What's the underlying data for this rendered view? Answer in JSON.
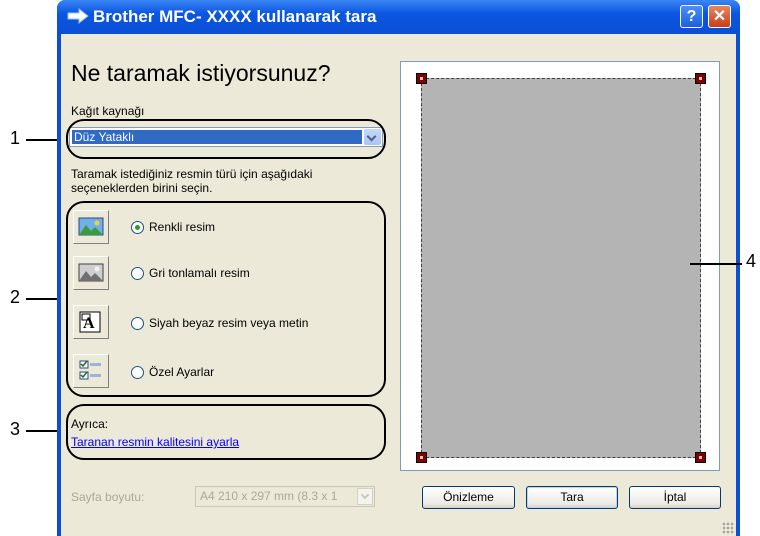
{
  "window": {
    "title": "Brother MFC- XXXX   kullanarak tara",
    "help_glyph": "?",
    "close_glyph": "✕"
  },
  "heading": "Ne taramak istiyorsunuz?",
  "paper_source": {
    "label": "Kağıt kaynağı",
    "selected": "Düz Yataklı"
  },
  "instruction": {
    "line1": "Taramak istediğiniz resmin türü için aşağıdaki",
    "line2": "seçeneklerden birini seçin."
  },
  "options": [
    {
      "label": "Renkli resim",
      "checked": true,
      "icon": "color-picture-icon"
    },
    {
      "label": "Gri tonlamalı resim",
      "checked": false,
      "icon": "grayscale-picture-icon"
    },
    {
      "label": "Siyah beyaz resim veya metin",
      "checked": false,
      "icon": "black-white-text-icon"
    },
    {
      "label": "Özel Ayarlar",
      "checked": false,
      "icon": "custom-settings-icon"
    }
  ],
  "also": {
    "label": "Ayrıca:",
    "link": "Taranan resmin kalitesini ayarla"
  },
  "page_size": {
    "label": "Sayfa boyutu:",
    "value": "A4 210 x 297 mm (8.3 x 1"
  },
  "buttons": {
    "preview": "Önizleme",
    "scan": "Tara",
    "cancel": "İptal"
  },
  "callouts": {
    "one": "1",
    "two": "2",
    "three": "3",
    "four": "4"
  }
}
